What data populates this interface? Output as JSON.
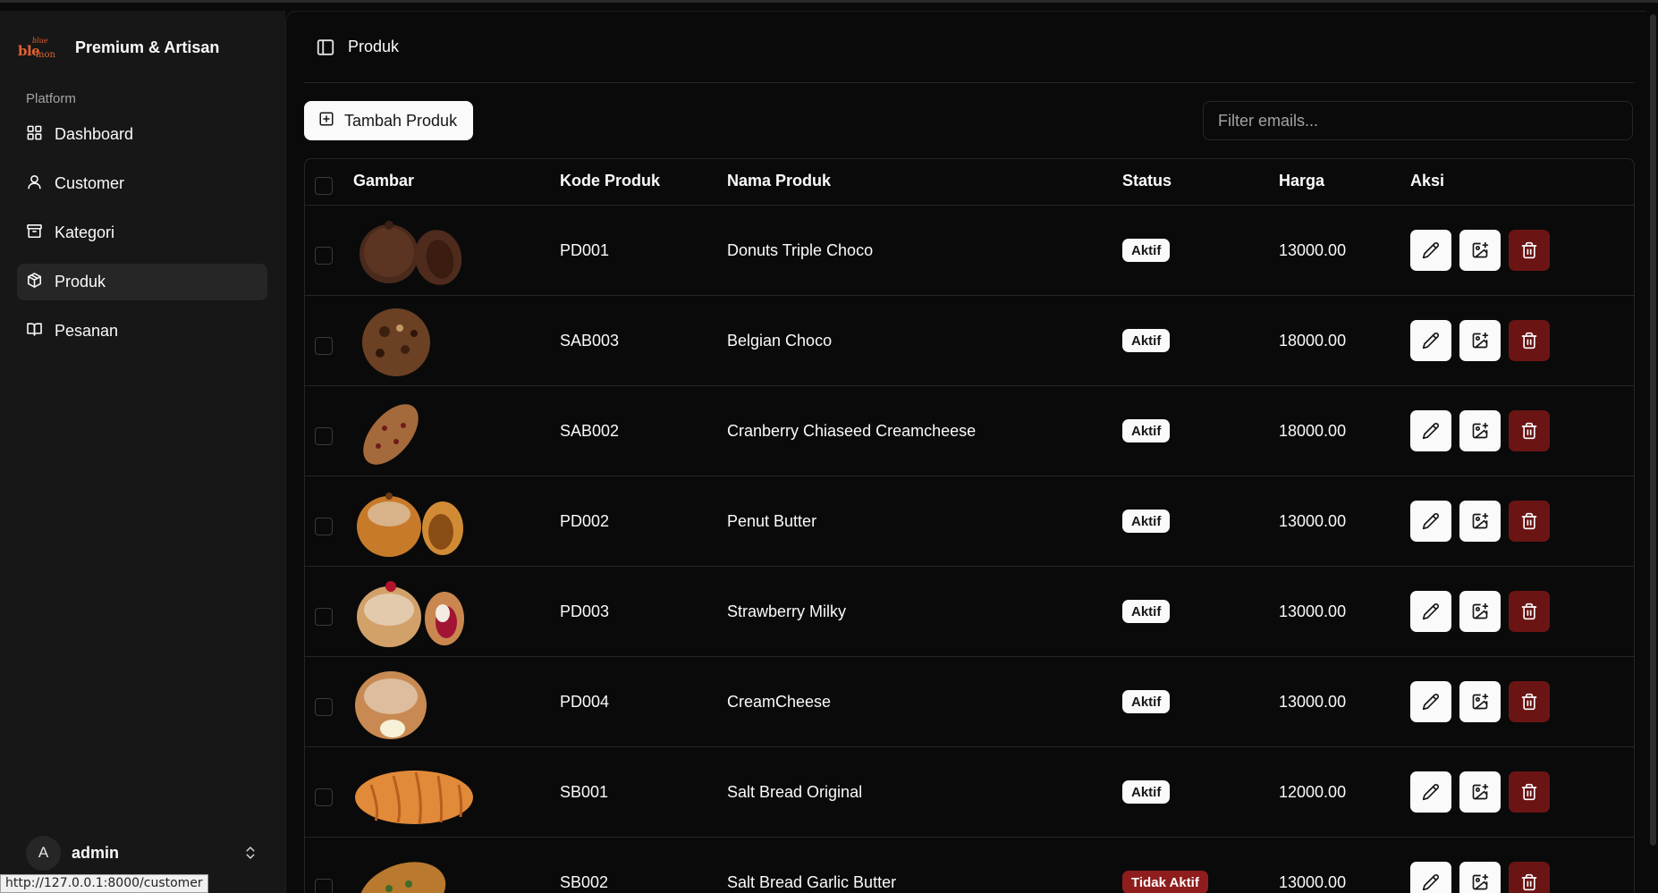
{
  "brand": {
    "name": "Premium & Artisan",
    "logo_main": "blemon",
    "logo_sub": "mon",
    "logo_top": "blue"
  },
  "sidebar": {
    "section_label": "Platform",
    "items": [
      {
        "label": "Dashboard",
        "icon": "layout-grid-icon",
        "active": false
      },
      {
        "label": "Customer",
        "icon": "user-icon",
        "active": false
      },
      {
        "label": "Kategori",
        "icon": "archive-icon",
        "active": false
      },
      {
        "label": "Produk",
        "icon": "package-icon",
        "active": true
      },
      {
        "label": "Pesanan",
        "icon": "book-open-icon",
        "active": false
      }
    ],
    "user": {
      "initial": "A",
      "name": "admin"
    }
  },
  "statusbar": {
    "url": "http://127.0.0.1:8000/customer"
  },
  "header": {
    "title": "Produk"
  },
  "toolbar": {
    "add_label": "Tambah Produk",
    "filter_placeholder": "Filter emails..."
  },
  "table": {
    "columns": [
      "Gambar",
      "Kode Produk",
      "Nama Produk",
      "Status",
      "Harga",
      "Aksi"
    ],
    "rows": [
      {
        "kode": "PD001",
        "nama": "Donuts Triple Choco",
        "status": "Aktif",
        "harga": "13000.00"
      },
      {
        "kode": "SAB003",
        "nama": "Belgian Choco",
        "status": "Aktif",
        "harga": "18000.00"
      },
      {
        "kode": "SAB002",
        "nama": "Cranberry Chiaseed Creamcheese",
        "status": "Aktif",
        "harga": "18000.00"
      },
      {
        "kode": "PD002",
        "nama": "Penut Butter",
        "status": "Aktif",
        "harga": "13000.00"
      },
      {
        "kode": "PD003",
        "nama": "Strawberry Milky",
        "status": "Aktif",
        "harga": "13000.00"
      },
      {
        "kode": "PD004",
        "nama": "CreamCheese",
        "status": "Aktif",
        "harga": "13000.00"
      },
      {
        "kode": "SB001",
        "nama": "Salt Bread Original",
        "status": "Aktif",
        "harga": "12000.00"
      },
      {
        "kode": "SB002",
        "nama": "Salt Bread Garlic Butter",
        "status": "Tidak Aktif",
        "harga": "13000.00"
      }
    ]
  },
  "colors": {
    "background": "#0a0a0a",
    "sidebar": "#171717",
    "brand_accent": "#e2622f",
    "danger": "#6b1414",
    "badge_inactive": "#8f1d1d"
  }
}
